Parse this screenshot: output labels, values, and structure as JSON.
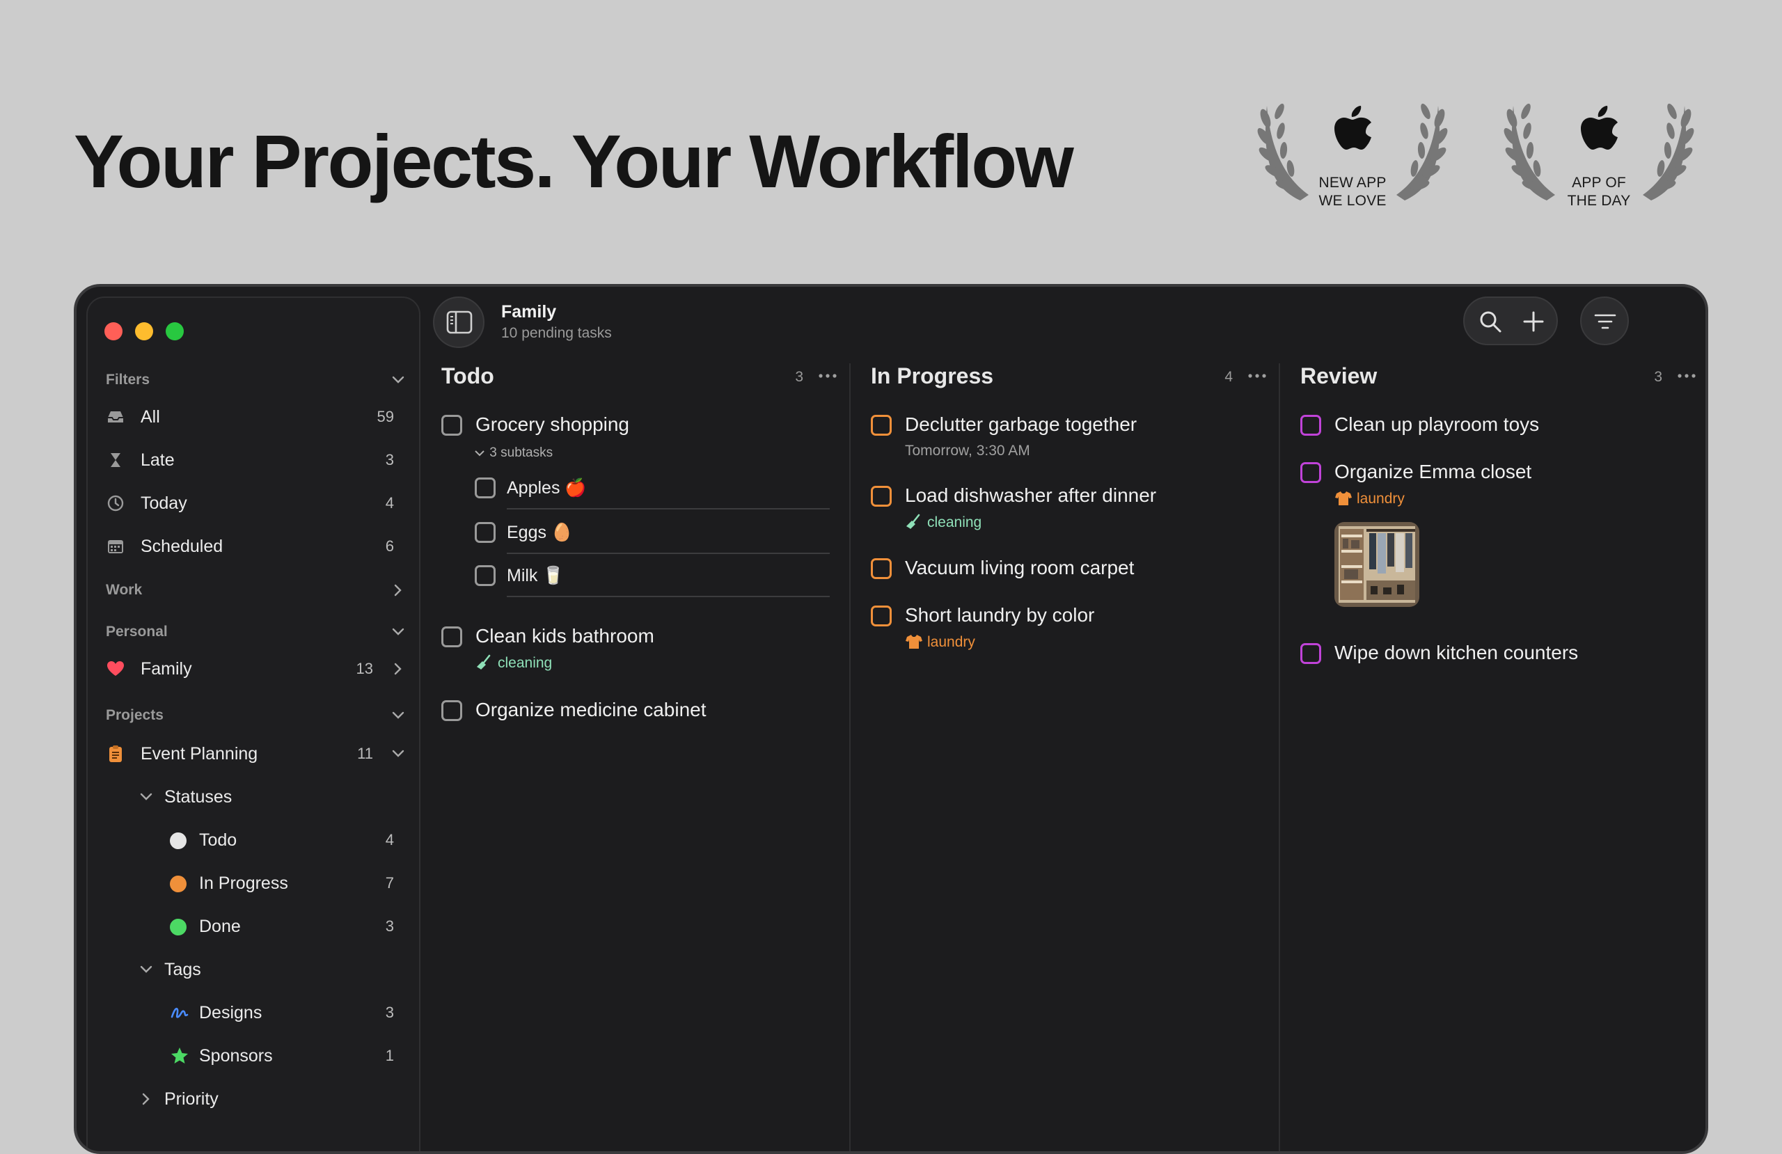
{
  "headline": "Your Projects. Your Workflow",
  "awards": [
    {
      "line1": "NEW APP",
      "line2": "WE LOVE"
    },
    {
      "line1": "APP OF",
      "line2": "THE DAY"
    }
  ],
  "colors": {
    "accent_todo": "#9a9a9a",
    "accent_in_progress": "#f0903a",
    "accent_review": "#c043d8",
    "tag_cleaning": "#8fe0b8",
    "tag_laundry": "#f0903a",
    "traffic_red": "#ff5f57",
    "traffic_yellow": "#febc2e",
    "traffic_green": "#28c840"
  },
  "sidebar": {
    "filters_label": "Filters",
    "filters": [
      {
        "label": "All",
        "count": "59",
        "icon": "tray-icon"
      },
      {
        "label": "Late",
        "count": "3",
        "icon": "hourglass-icon"
      },
      {
        "label": "Today",
        "count": "4",
        "icon": "clock-icon"
      },
      {
        "label": "Scheduled",
        "count": "6",
        "icon": "calendar-icon"
      }
    ],
    "work_label": "Work",
    "personal_label": "Personal",
    "family": {
      "label": "Family",
      "count": "13",
      "icon": "heart-icon"
    },
    "projects_label": "Projects",
    "event_planning": {
      "label": "Event Planning",
      "count": "11",
      "icon": "clipboard-icon"
    },
    "statuses_label": "Statuses",
    "statuses": [
      {
        "label": "Todo",
        "count": "4",
        "color": "#e6e6e6"
      },
      {
        "label": "In Progress",
        "count": "7",
        "color": "#f0903a"
      },
      {
        "label": "Done",
        "count": "3",
        "color": "#4cd964"
      }
    ],
    "tags_label": "Tags",
    "tags": [
      {
        "label": "Designs",
        "count": "3",
        "icon": "scribble-icon"
      },
      {
        "label": "Sponsors",
        "count": "1",
        "icon": "star-icon"
      }
    ],
    "priority_label": "Priority"
  },
  "header": {
    "title": "Family",
    "subtitle": "10 pending tasks"
  },
  "columns": {
    "todo": {
      "title": "Todo",
      "count": "3",
      "grocery": "Grocery shopping",
      "subtasks_label": "3 subtasks",
      "subtasks": [
        "Apples 🍎",
        "Eggs 🥚",
        "Milk 🥛"
      ],
      "bathroom": "Clean kids bathroom",
      "bathroom_tag": "cleaning",
      "medicine": "Organize medicine cabinet"
    },
    "in_progress": {
      "title": "In Progress",
      "count": "4",
      "declutter": "Declutter garbage together",
      "declutter_due": "Tomorrow, 3:30 AM",
      "dishwasher": "Load dishwasher after dinner",
      "dishwasher_tag": "cleaning",
      "vacuum": "Vacuum living room carpet",
      "laundry": "Short laundry by color",
      "laundry_tag": "laundry"
    },
    "review": {
      "title": "Review",
      "count": "3",
      "playroom": "Clean up playroom toys",
      "closet": "Organize Emma closet",
      "closet_tag": "laundry",
      "kitchen": "Wipe down kitchen counters"
    }
  }
}
